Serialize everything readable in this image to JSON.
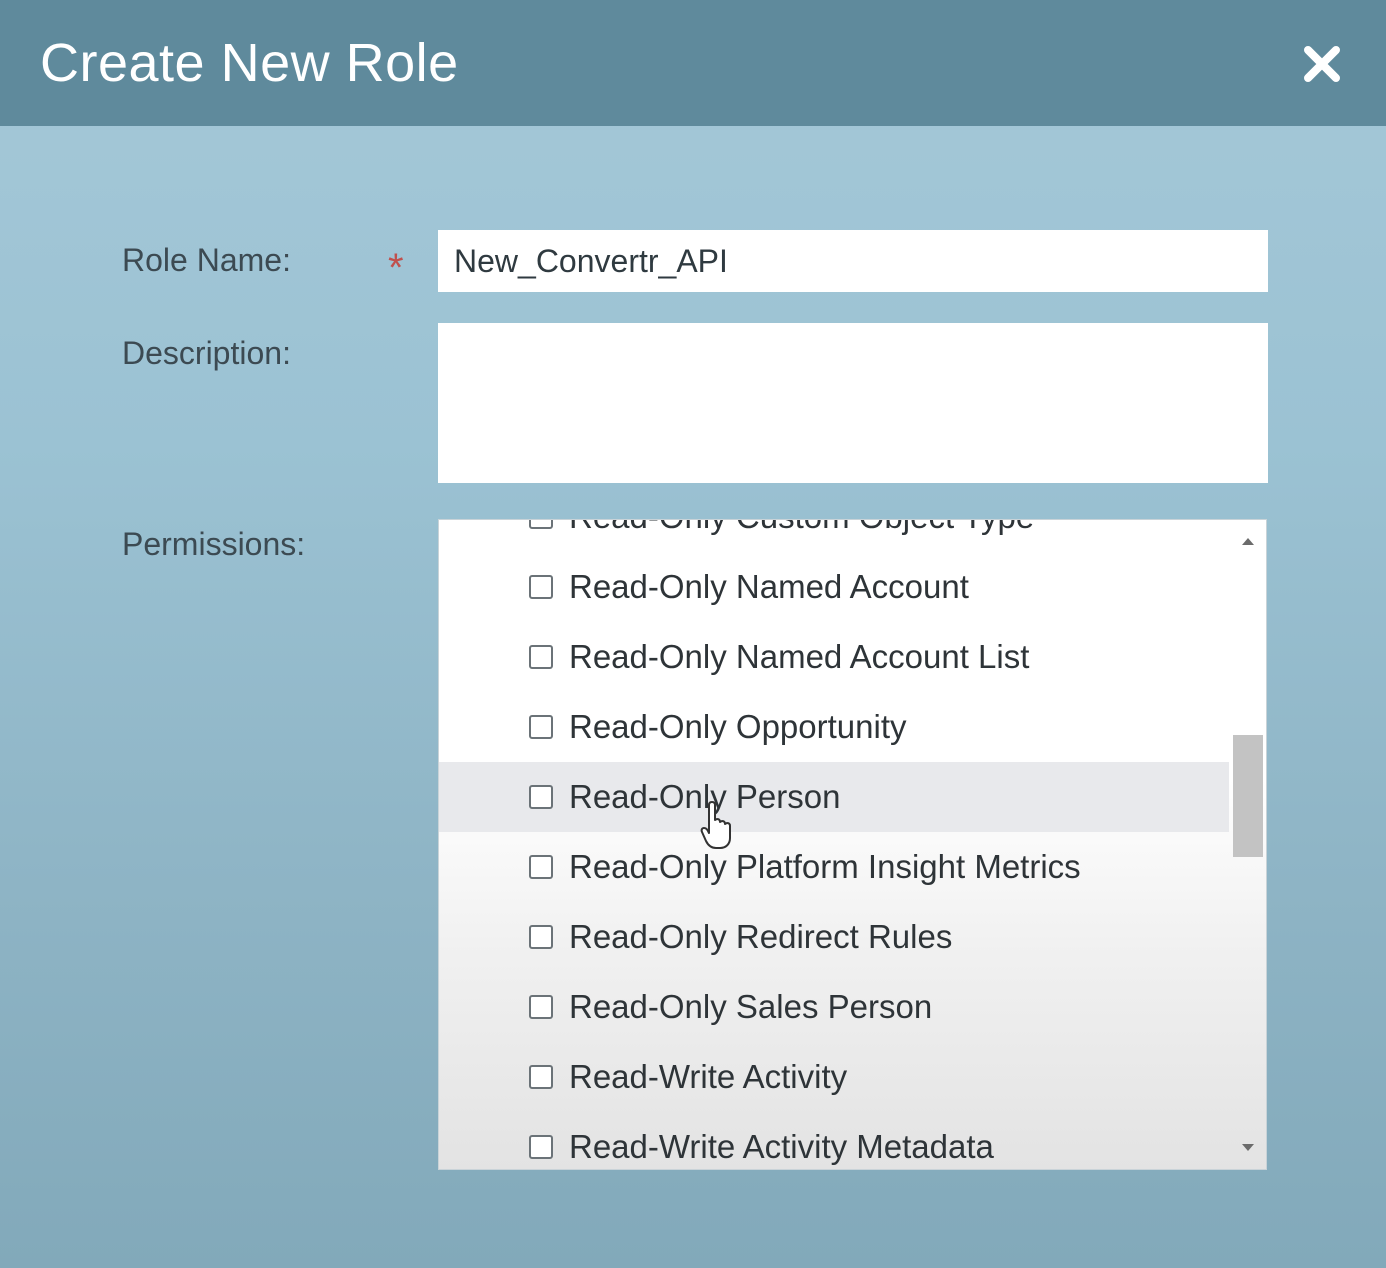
{
  "dialog": {
    "title": "Create New Role",
    "close_icon": "close-icon"
  },
  "form": {
    "role_name": {
      "label": "Role Name:",
      "required_marker": "*",
      "value": "New_Convertr_API"
    },
    "description": {
      "label": "Description:",
      "value": ""
    },
    "permissions": {
      "label": "Permissions:",
      "items": [
        {
          "label": "Read-Only Custom Object Type",
          "checked": false
        },
        {
          "label": "Read-Only Named Account",
          "checked": false
        },
        {
          "label": "Read-Only Named Account List",
          "checked": false
        },
        {
          "label": "Read-Only Opportunity",
          "checked": false
        },
        {
          "label": "Read-Only Person",
          "checked": false,
          "hovered": true
        },
        {
          "label": "Read-Only Platform Insight Metrics",
          "checked": false
        },
        {
          "label": "Read-Only Redirect Rules",
          "checked": false
        },
        {
          "label": "Read-Only Sales Person",
          "checked": false
        },
        {
          "label": "Read-Write Activity",
          "checked": false
        },
        {
          "label": "Read-Write Activity Metadata",
          "checked": false
        }
      ]
    }
  },
  "colors": {
    "titlebar": "#5f8a9c",
    "required": "#c0504d",
    "hover_row": "#e8e9ec"
  }
}
